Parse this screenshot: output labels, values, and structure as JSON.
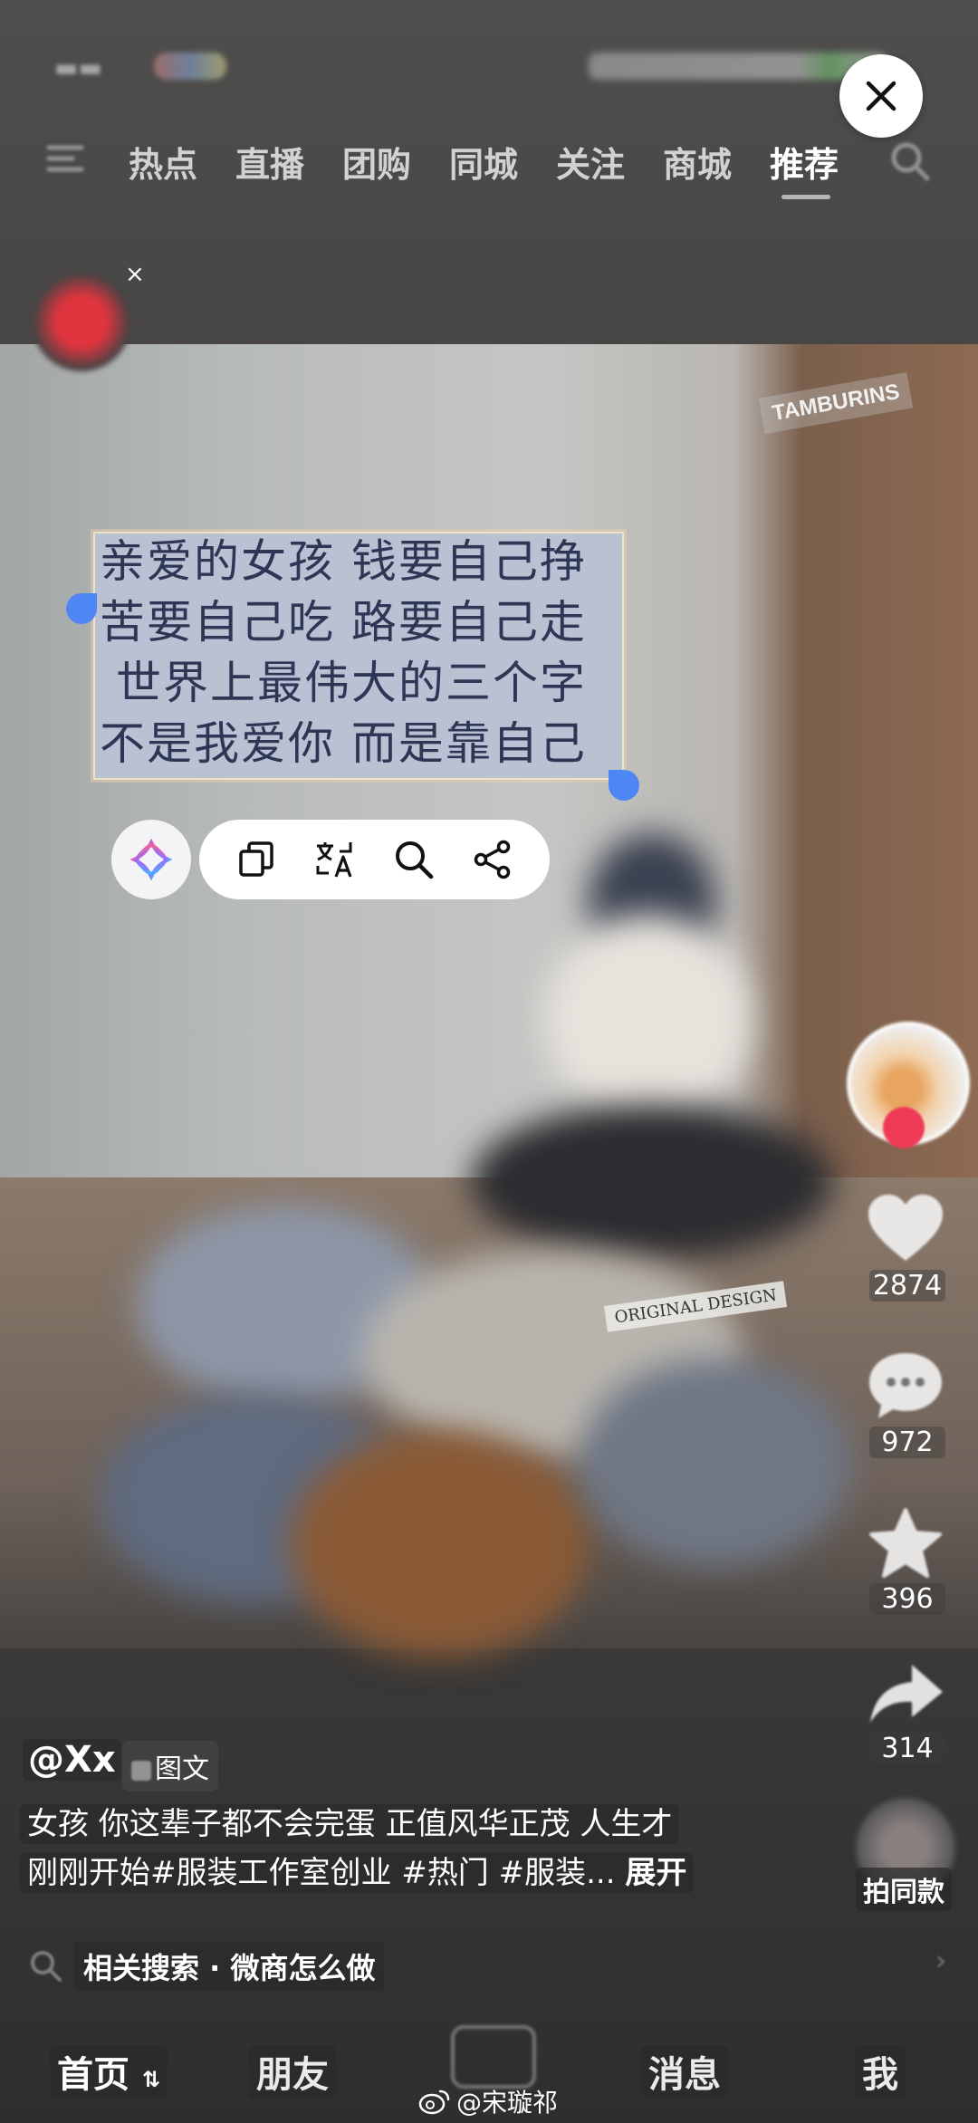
{
  "top_tabs": [
    "热点",
    "直播",
    "团购",
    "同城",
    "关注",
    "商城",
    "推荐"
  ],
  "active_tab": "推荐",
  "red_packet_close": "×",
  "photo_labels": {
    "brand": "TAMBURINS",
    "design": "ORIGINAL DESIGN"
  },
  "selected_text": {
    "lines": [
      "亲爱的女孩 钱要自己挣",
      "苦要自己吃 路要自己走",
      "世界上最伟大的三个字",
      "不是我爱你 而是靠自己"
    ],
    "highlight_color": "#b9c1d2",
    "handle_color": "#4f86f5"
  },
  "text_actions": {
    "icons": [
      "ai-assistant-icon",
      "copy-icon",
      "translate-icon",
      "search-icon",
      "share-icon"
    ]
  },
  "right_rail": {
    "like_count": "2874",
    "comment_count": "972",
    "favorite_count": "396",
    "share_count": "314",
    "same_style_label": "拍同款",
    "follow_color": "#ef3a56"
  },
  "post": {
    "author": "@Xx",
    "type": "图文",
    "caption_line1": "女孩 你这辈子都不会完蛋 正值风华正茂 人生才",
    "caption_line2": "刚刚开始#服装工作室创业 #热门 #服装...",
    "expand_label": "展开"
  },
  "related_search": "相关搜索 · 微商怎么做",
  "bottom_nav": {
    "home": "首页",
    "friends": "朋友",
    "messages": "消息",
    "me": "我"
  },
  "watermark": "@宋璇祁"
}
